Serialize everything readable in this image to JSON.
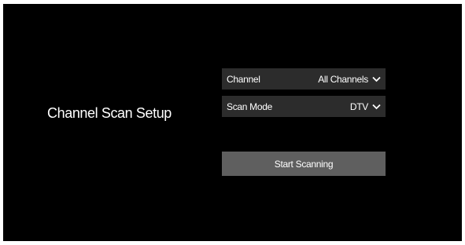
{
  "screen": {
    "title": "Channel Scan Setup"
  },
  "settings": {
    "channel": {
      "label": "Channel",
      "value": "All Channels"
    },
    "scan_mode": {
      "label": "Scan Mode",
      "value": "DTV"
    }
  },
  "actions": {
    "start_label": "Start Scanning"
  },
  "icons": {
    "dropdown": "chevron-down-icon"
  },
  "colors": {
    "background": "#000000",
    "row_background": "#2c2c2c",
    "button_background": "#5f5f5f",
    "text": "#ffffff"
  }
}
